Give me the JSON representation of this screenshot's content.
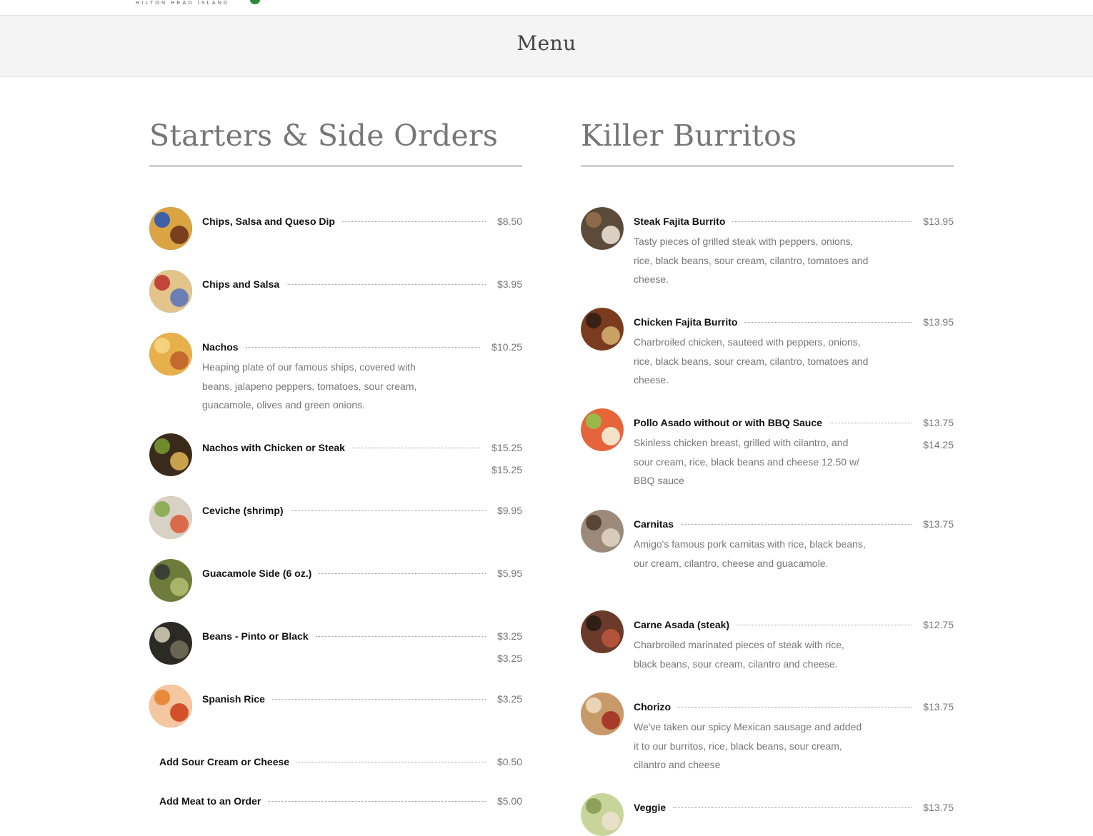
{
  "header": {
    "logo_text": "HILTON HEAD ISLAND"
  },
  "banner": {
    "title": "Menu"
  },
  "colors": {
    "logo_green": "#2e8b3c",
    "banner_bg": "#f4f4f4",
    "heading_gray": "#767676",
    "price_gray": "#777777"
  },
  "starters": {
    "title": "Starters & Side Orders",
    "items": [
      {
        "name": "Chips, Salsa and Queso Dip",
        "price": "$8.50",
        "icon": "chips-queso-photo"
      },
      {
        "name": "Chips and Salsa",
        "price": "$3.95",
        "icon": "chips-salsa-photo"
      },
      {
        "name": "Nachos",
        "price": "$10.25",
        "desc": "Heaping plate of our famous ships, covered with beans, jalapeno peppers, tomatoes, sour cream, guacamole, olives and green onions.",
        "icon": "nachos-photo"
      },
      {
        "name": "Nachos with Chicken or Steak",
        "price": "$15.25",
        "price2": "$15.25",
        "icon": "nachos-meat-photo"
      },
      {
        "name": "Ceviche (shrimp)",
        "price": "$9.95",
        "icon": "ceviche-photo"
      },
      {
        "name": "Guacamole Side (6 oz.)",
        "price": "$5.95",
        "icon": "guacamole-photo"
      },
      {
        "name": "Beans - Pinto or Black",
        "price": "$3.25",
        "price2": "$3.25",
        "icon": "beans-photo"
      },
      {
        "name": "Spanish Rice",
        "price": "$3.25",
        "icon": "rice-photo"
      },
      {
        "name": "Add Sour Cream or Cheese",
        "price": "$0.50"
      },
      {
        "name": "Add Meat to an Order",
        "price": "$5.00"
      }
    ]
  },
  "burritos": {
    "title": "Killer Burritos",
    "items": [
      {
        "name": "Steak Fajita Burrito",
        "price": "$13.95",
        "desc": "Tasty pieces of grilled steak with peppers, onions, rice, black beans, sour cream, cilantro, tomatoes and cheese.",
        "icon": "steak-burrito-photo"
      },
      {
        "name": "Chicken Fajita Burrito",
        "price": "$13.95",
        "desc": "Charbroiled chicken, sauteed with peppers, onions, rice, black beans, sour cream, cilantro, tomatoes and cheese.",
        "icon": "chicken-burrito-photo"
      },
      {
        "name": "Pollo Asado without or with BBQ Sauce",
        "price": "$13.75",
        "price2": "$14.25",
        "desc": "Skinless chicken breast, grilled with cilantro, and sour cream, rice, black beans and cheese 12.50 w/ BBQ sauce",
        "icon": "pollo-asado-photo"
      },
      {
        "name": "Carnitas",
        "price": "$13.75",
        "desc": "Amigo's famous pork carnitas with rice, black beans, our cream, cilantro, cheese and guacamole.",
        "icon": "carnitas-photo"
      },
      {
        "name": "Carne Asada (steak)",
        "price": "$12.75",
        "desc": "Charbroiled marinated pieces of steak with rice, black beans, sour cream, cilantro and cheese.",
        "icon": "carne-asada-photo"
      },
      {
        "name": "Chorizo",
        "price": "$13.75",
        "desc": "We've taken our spicy Mexican sausage and added it to our burritos, rice, black beans, sour cream, cilantro and cheese",
        "icon": "chorizo-photo"
      },
      {
        "name": "Veggie",
        "price": "$13.75",
        "icon": "veggie-photo"
      }
    ]
  }
}
